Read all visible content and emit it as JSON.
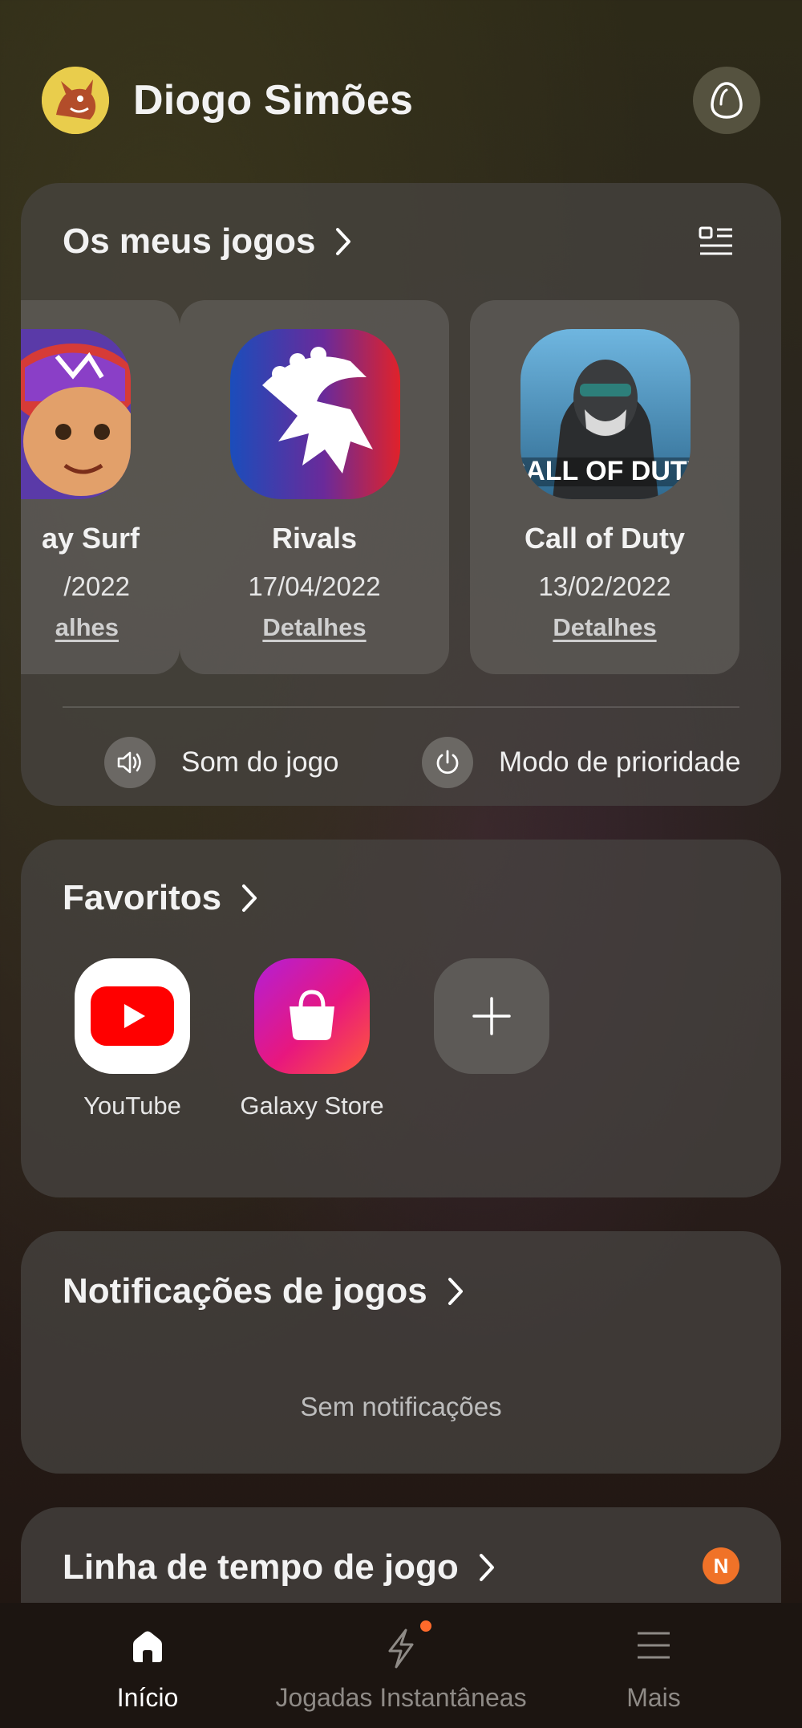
{
  "user": {
    "name": "Diogo Simões"
  },
  "games": {
    "title": "Os meus jogos",
    "items": [
      {
        "name": "ay Surf",
        "date": "/2022",
        "link": "alhes"
      },
      {
        "name": "Rivals",
        "date": "17/04/2022",
        "link": "Detalhes"
      },
      {
        "name": "Call of Duty",
        "date": "13/02/2022",
        "link": "Detalhes"
      }
    ],
    "cod_logo_text": "CALL OF DUTY",
    "sound_label": "Som do jogo",
    "priority_label": "Modo de prioridade"
  },
  "favorites": {
    "title": "Favoritos",
    "items": [
      {
        "label": "YouTube"
      },
      {
        "label": "Galaxy Store"
      }
    ]
  },
  "notifications": {
    "title": "Notificações de jogos",
    "empty": "Sem notificações"
  },
  "timeline": {
    "title": "Linha de tempo de jogo",
    "badge": "N"
  },
  "nav": {
    "items": [
      {
        "label": "Início",
        "icon": "home-icon",
        "active": true
      },
      {
        "label": "Jogadas Instantâneas",
        "icon": "lightning-icon",
        "active": false
      },
      {
        "label": "Mais",
        "icon": "menu-icon",
        "active": false
      }
    ]
  },
  "colors": {
    "accent_orange": "#f07228",
    "youtube_red": "#ff0000",
    "store_pink": "#e0167a"
  }
}
